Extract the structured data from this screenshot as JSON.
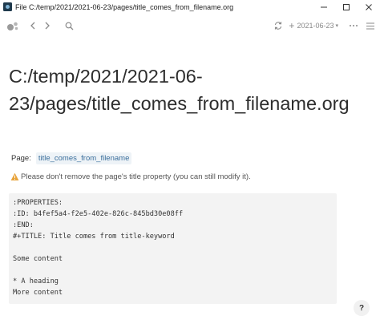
{
  "window": {
    "title": "File C:/temp/2021/2021-06-23/pages/title_comes_from_filename.org"
  },
  "toolbar": {
    "date_label": "2021-06-23",
    "icons": [
      "sidebar-toggle-icon",
      "back-icon",
      "forward-icon",
      "search-icon",
      "sync-icon",
      "plus-icon",
      "more-icon",
      "menu-icon"
    ]
  },
  "page": {
    "title": "C:/temp/2021/2021-06-23/pages/title_comes_from_filename.org",
    "property_key": "Page:",
    "property_value": "title_comes_from_filename",
    "warning": "Please don't remove the page's title property (you can still modify it).",
    "code_lines": [
      ":PROPERTIES:",
      ":ID: b4fef5a4-f2e5-402e-826c-845bd30e08ff",
      ":END:",
      "#+TITLE: Title comes from title-keyword",
      "",
      "Some content",
      "",
      "* A heading",
      "More content"
    ]
  },
  "help": {
    "label": "?"
  },
  "colors": {
    "link": "#3b6f9c",
    "code_bg": "#f3f3f3",
    "warning": "#e8a33a"
  }
}
